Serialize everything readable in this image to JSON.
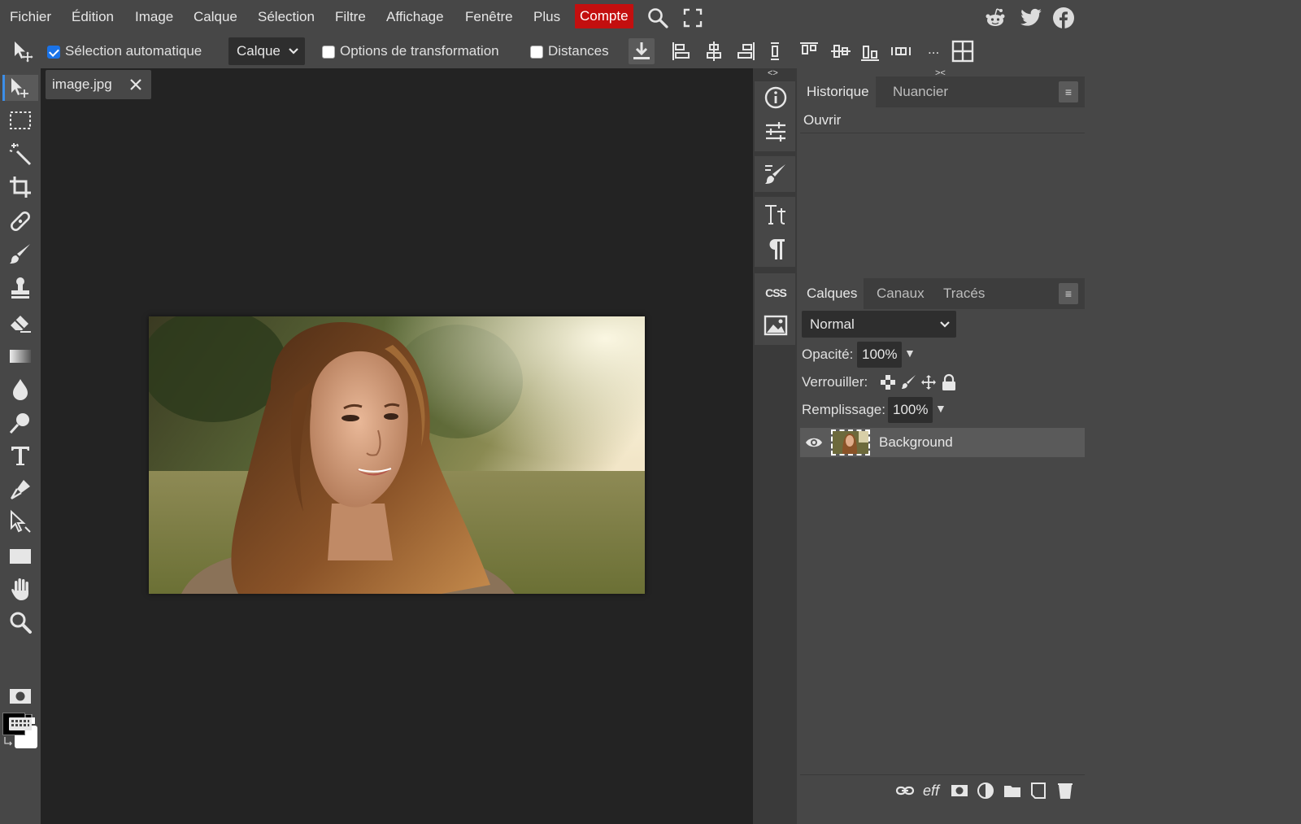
{
  "menu": {
    "items": [
      "Fichier",
      "Édition",
      "Image",
      "Calque",
      "Sélection",
      "Filtre",
      "Affichage",
      "Fenêtre",
      "Plus"
    ],
    "account_label": "Compte",
    "accent_color": "#c30f0f"
  },
  "options": {
    "auto_select_label": "Sélection automatique",
    "auto_select_checked": true,
    "target_select_value": "Calque",
    "transform_label": "Options de transformation",
    "transform_checked": false,
    "distances_label": "Distances",
    "distances_checked": false,
    "more_label": "..."
  },
  "document": {
    "tab_name": "image.jpg"
  },
  "collapse": {
    "left": "<>",
    "right": "><"
  },
  "history_panel": {
    "tabs": [
      "Historique",
      "Nuancier"
    ],
    "entries": [
      "Ouvrir"
    ],
    "menu_label": "≡"
  },
  "layers_panel": {
    "tabs": [
      "Calques",
      "Canaux",
      "Tracés"
    ],
    "menu_label": "≡",
    "blend_mode": "Normal",
    "opacity_label": "Opacité:",
    "opacity_value": "100%",
    "lock_label": "Verrouiller:",
    "fill_label": "Remplissage:",
    "fill_value": "100%",
    "layers": [
      {
        "name": "Background",
        "visible": true
      }
    ],
    "effects_label": "eff"
  },
  "css_label": "CSS"
}
